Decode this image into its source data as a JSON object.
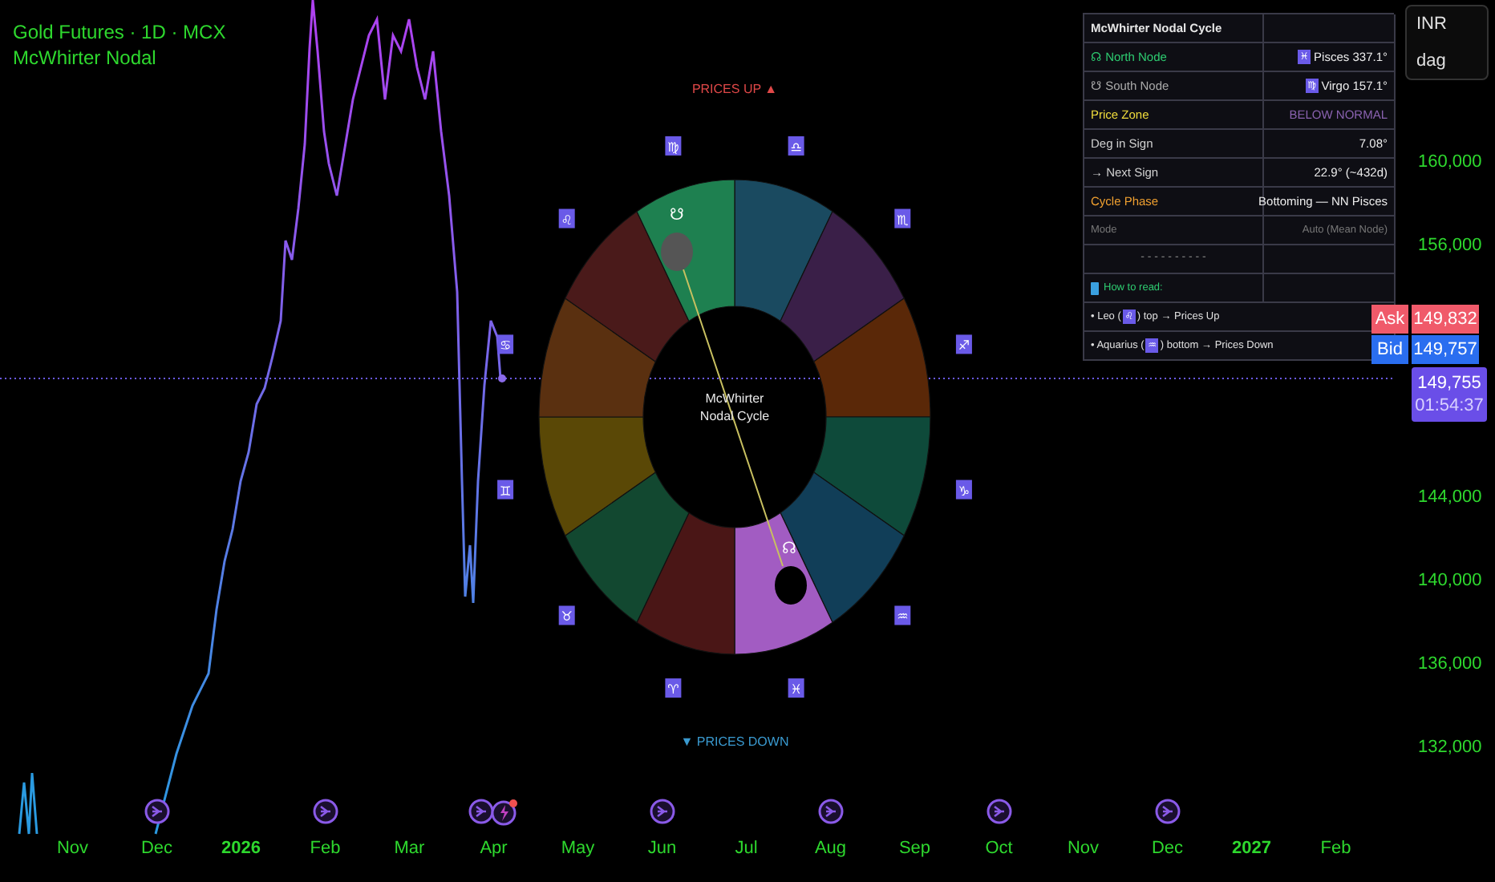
{
  "legend": {
    "symbol": "Gold Futures · 1D · MCX",
    "indicator": "McWhirter Nodal"
  },
  "wheel": {
    "title": "McWhirter Nodal Cycle",
    "top_label": "PRICES UP ▲",
    "bottom_label": "▼ PRICES DOWN",
    "segments": [
      {
        "color": "#1a4a60"
      },
      {
        "color": "#3a1f48"
      },
      {
        "color": "#5a2808"
      },
      {
        "color": "#0e4a3a"
      },
      {
        "color": "#113e58"
      },
      {
        "color": "#a25cc2"
      },
      {
        "color": "#4a1616"
      },
      {
        "color": "#124830"
      },
      {
        "color": "#5a4806"
      },
      {
        "color": "#5a3010"
      },
      {
        "color": "#4a1a1a"
      },
      {
        "color": "#1e8050"
      }
    ],
    "signs": [
      {
        "glyph": "♍"
      },
      {
        "glyph": "♎"
      },
      {
        "glyph": "♏"
      },
      {
        "glyph": "♐"
      },
      {
        "glyph": "♑"
      },
      {
        "glyph": "♒"
      },
      {
        "glyph": "♓"
      },
      {
        "glyph": "♈"
      },
      {
        "glyph": "♉"
      },
      {
        "glyph": "♊"
      },
      {
        "glyph": "♋"
      },
      {
        "glyph": "♌"
      }
    ],
    "south_node": {
      "glyph": "☋"
    },
    "north_node": {
      "glyph": "☊"
    }
  },
  "table": {
    "rows": [
      {
        "kind": "title",
        "label": "McWhirter Nodal Cycle"
      },
      {
        "kind": "north",
        "label": "☊ North Node",
        "glyph": "♓",
        "value": "Pisces 337.1°"
      },
      {
        "kind": "south",
        "label": "☋ South Node",
        "glyph": "♍",
        "value": "Virgo 157.1°"
      },
      {
        "kind": "zone",
        "label": "Price Zone",
        "value": "BELOW NORMAL"
      },
      {
        "kind": "plain",
        "label": "Deg in Sign",
        "value": "7.08°"
      },
      {
        "kind": "plain",
        "label": "→ Next Sign",
        "value": "22.9° (~432d)"
      },
      {
        "kind": "phase",
        "label": "Cycle Phase",
        "value": "Bottoming — NN Pisces"
      },
      {
        "kind": "mode",
        "label": "Mode",
        "value": "Auto (Mean Node)"
      },
      {
        "kind": "separator",
        "label": "- - - - - - - - - -"
      },
      {
        "kind": "howto",
        "label": "How to read:"
      },
      {
        "kind": "note",
        "before": "• Leo (",
        "glyph": "♌",
        "after": ") top → Prices Up"
      },
      {
        "kind": "note",
        "before": "• Aquarius (",
        "glyph": "♒",
        "after": ") bottom → Prices Down"
      }
    ]
  },
  "currency_box": {
    "currency": "INR",
    "unit": "dag"
  },
  "price_axis": {
    "upper_ticks": [
      "160,000",
      "156,000"
    ],
    "lower_ticks": [
      "144,000",
      "140,000",
      "136,000",
      "132,000"
    ]
  },
  "quotes": {
    "ask_label": "Ask",
    "ask": "149,832",
    "bid_label": "Bid",
    "bid": "149,757",
    "last": "149,755",
    "countdown": "01:54:37"
  },
  "time_axis": [
    {
      "label": "Nov",
      "bold": false
    },
    {
      "label": "Dec",
      "bold": false
    },
    {
      "label": "2026",
      "bold": true
    },
    {
      "label": "Feb",
      "bold": false
    },
    {
      "label": "Mar",
      "bold": false
    },
    {
      "label": "Apr",
      "bold": false
    },
    {
      "label": "May",
      "bold": false
    },
    {
      "label": "Jun",
      "bold": false
    },
    {
      "label": "Jul",
      "bold": false
    },
    {
      "label": "Aug",
      "bold": false
    },
    {
      "label": "Sep",
      "bold": false
    },
    {
      "label": "Oct",
      "bold": false
    },
    {
      "label": "Nov",
      "bold": false
    },
    {
      "label": "Dec",
      "bold": false
    },
    {
      "label": "2027",
      "bold": true
    },
    {
      "label": "Feb",
      "bold": false
    }
  ]
}
